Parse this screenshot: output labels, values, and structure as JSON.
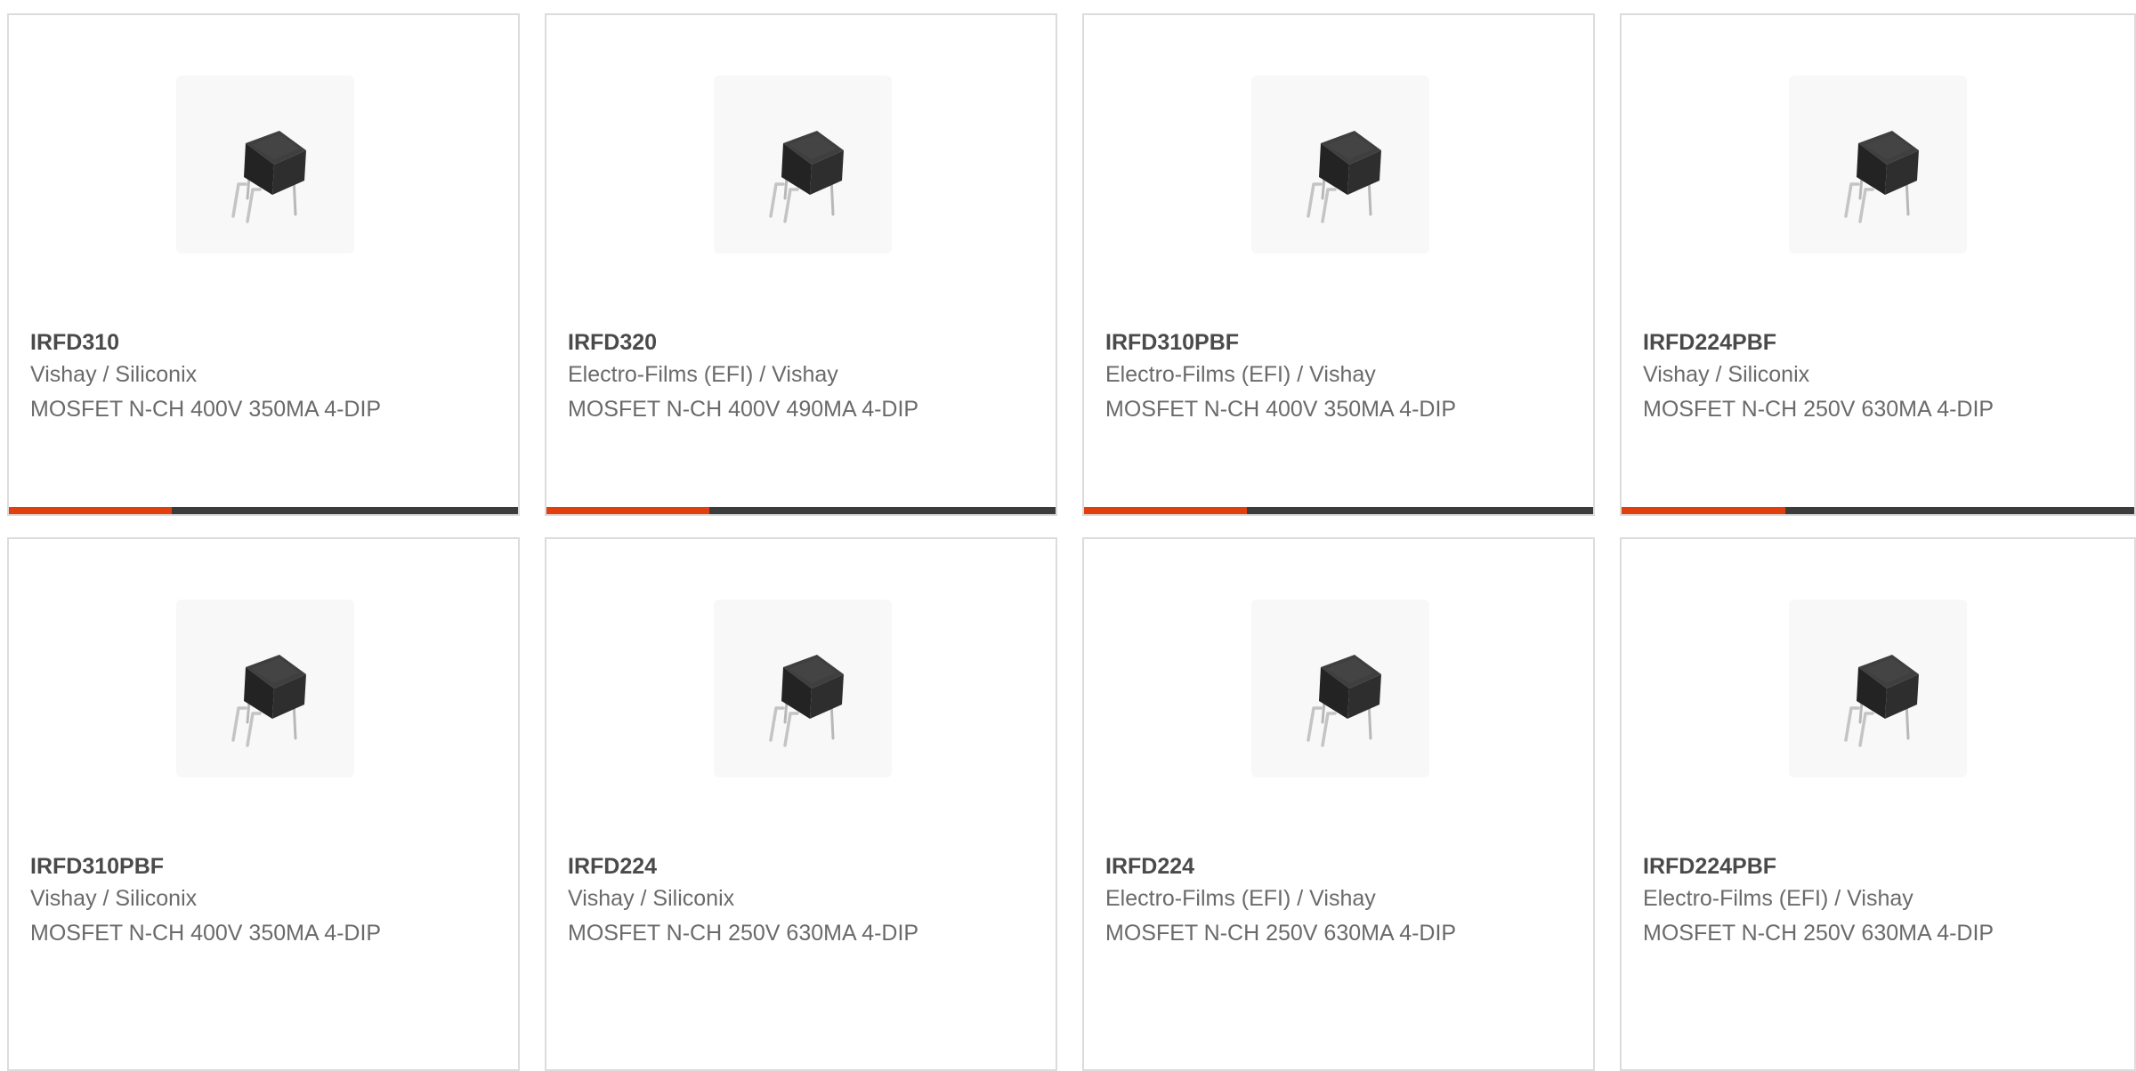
{
  "colors": {
    "accent": "#e1400e",
    "bar_track": "#3c3c3c",
    "card_border": "#dcdcdc",
    "title_text": "#4a4a4a",
    "body_text": "#6a6a6a"
  },
  "products": [
    {
      "part_number": "IRFD310",
      "manufacturer": "Vishay / Siliconix",
      "description": "MOSFET N-CH 400V 350MA 4-DIP",
      "image_icon": "dip-4-chip-icon",
      "progress_fraction": 0.32
    },
    {
      "part_number": "IRFD320",
      "manufacturer": "Electro-Films (EFI) / Vishay",
      "description": "MOSFET N-CH 400V 490MA 4-DIP",
      "image_icon": "dip-4-chip-icon",
      "progress_fraction": 0.32
    },
    {
      "part_number": "IRFD310PBF",
      "manufacturer": "Electro-Films (EFI) / Vishay",
      "description": "MOSFET N-CH 400V 350MA 4-DIP",
      "image_icon": "dip-4-chip-icon",
      "progress_fraction": 0.32
    },
    {
      "part_number": "IRFD224PBF",
      "manufacturer": "Vishay / Siliconix",
      "description": "MOSFET N-CH 250V 630MA 4-DIP",
      "image_icon": "dip-4-chip-icon",
      "progress_fraction": 0.32
    },
    {
      "part_number": "IRFD310PBF",
      "manufacturer": "Vishay / Siliconix",
      "description": "MOSFET N-CH 400V 350MA 4-DIP",
      "image_icon": "dip-4-chip-icon"
    },
    {
      "part_number": "IRFD224",
      "manufacturer": "Vishay / Siliconix",
      "description": "MOSFET N-CH 250V 630MA 4-DIP",
      "image_icon": "dip-4-chip-icon"
    },
    {
      "part_number": "IRFD224",
      "manufacturer": "Electro-Films (EFI) / Vishay",
      "description": "MOSFET N-CH 250V 630MA 4-DIP",
      "image_icon": "dip-4-chip-icon"
    },
    {
      "part_number": "IRFD224PBF",
      "manufacturer": "Electro-Films (EFI) / Vishay",
      "description": "MOSFET N-CH 250V 630MA 4-DIP",
      "image_icon": "dip-4-chip-icon"
    }
  ]
}
